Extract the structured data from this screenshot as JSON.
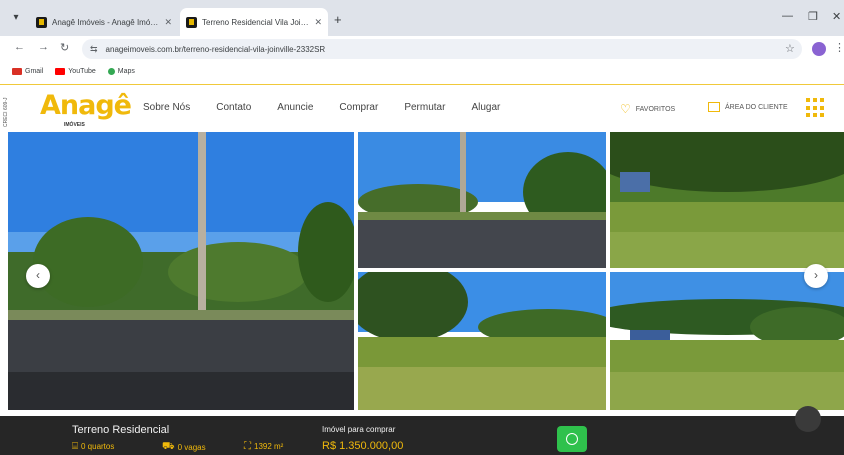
{
  "browser": {
    "tabs": [
      {
        "title": "Anagê Imóveis - Anagê Imóveis"
      },
      {
        "title": "Terreno Residencial Vila Joinvil"
      }
    ],
    "url": "anageimoveis.com.br/terreno-residencial-vila-joinville-2332SR",
    "bookmarks": [
      {
        "label": "Gmail",
        "icon": "gmail-icon"
      },
      {
        "label": "YouTube",
        "icon": "youtube-icon"
      },
      {
        "label": "Maps",
        "icon": "maps-icon"
      }
    ]
  },
  "site": {
    "side_label": "CRECI 609-J",
    "logo": {
      "word": "Anagê",
      "sub": "IMÓVEIS"
    },
    "menu": [
      "Sobre Nós",
      "Contato",
      "Anuncie",
      "Comprar",
      "Permutar",
      "Alugar"
    ],
    "favorites": "FAVORITOS",
    "client_area": "ÁREA DO CLIENTE"
  },
  "listing": {
    "title": "Terreno Residencial",
    "bedrooms": "0 quartos",
    "parking": "0 vagas",
    "area": "1392 m²",
    "sale_label": "Imóvel para comprar",
    "price": "R$ 1.350.000,00"
  },
  "colors": {
    "brand": "#f0b90b",
    "bar": "#262626",
    "whatsapp": "#2fc14c"
  }
}
